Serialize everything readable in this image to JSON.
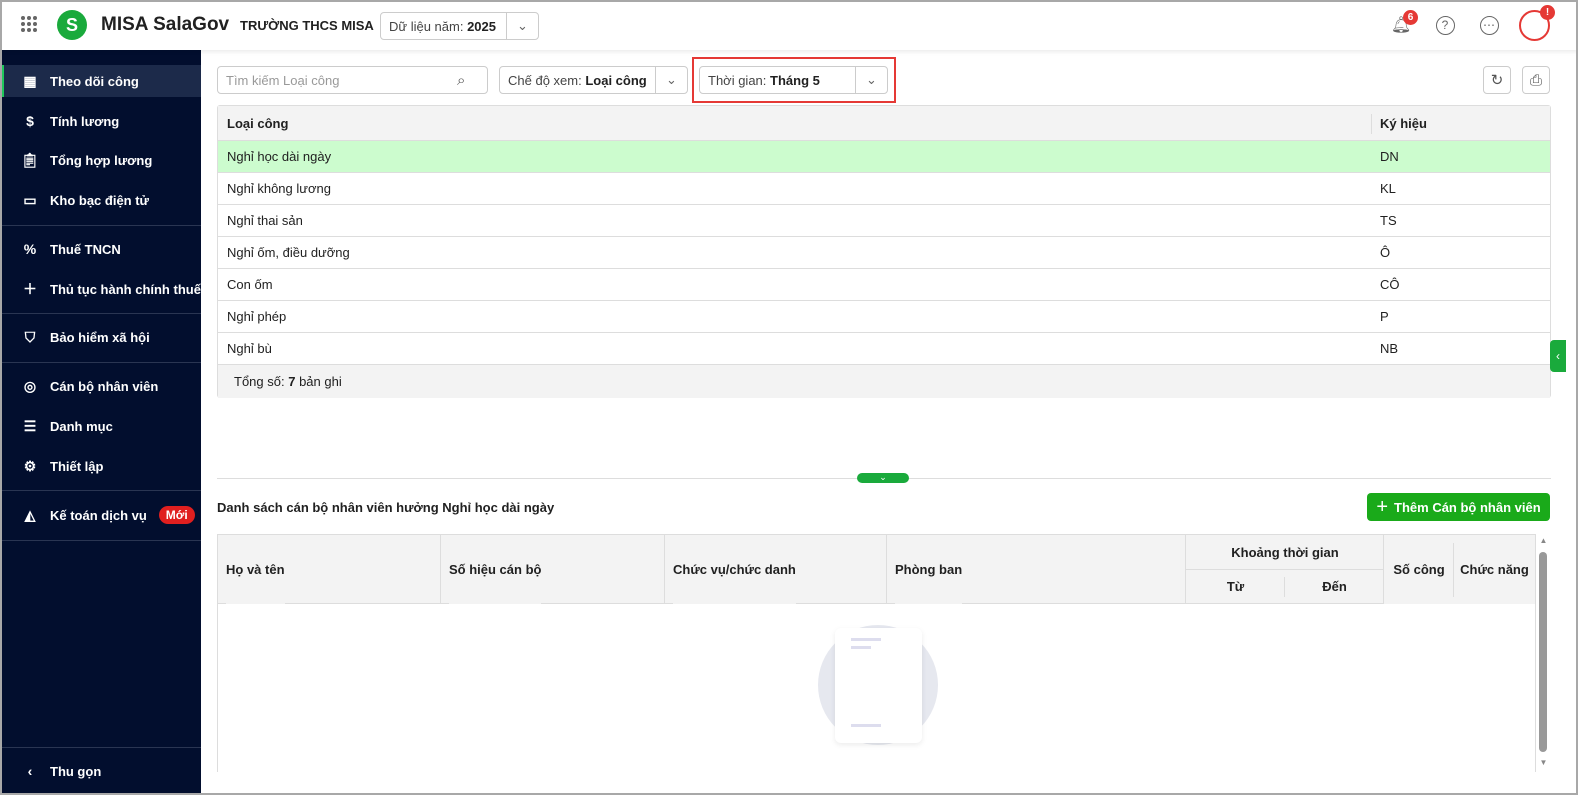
{
  "header": {
    "brand": "MISA SalaGov",
    "school": "TRƯỜNG THCS MISA",
    "year_label": "Dữ liệu năm:",
    "year_value": "2025",
    "notif_count": "6",
    "avatar_badge": "!"
  },
  "sidebar": {
    "items": [
      {
        "label": "Theo dõi công",
        "icon": "calendar-icon"
      },
      {
        "label": "Tính lương",
        "icon": "money-icon"
      },
      {
        "label": "Tổng hợp lương",
        "icon": "clipboard-icon"
      },
      {
        "label": "Kho bạc điện tử",
        "icon": "monitor-icon"
      },
      {
        "label": "Thuế TNCN",
        "icon": "tax-doc-icon"
      },
      {
        "label": "Thủ tục hành chính thuế",
        "icon": "doc-plus-icon"
      },
      {
        "label": "Bảo hiểm xã hội",
        "icon": "shield-icon"
      },
      {
        "label": "Cán bộ nhân viên",
        "icon": "people-icon"
      },
      {
        "label": "Danh mục",
        "icon": "list-icon"
      },
      {
        "label": "Thiết lập",
        "icon": "gear-icon"
      },
      {
        "label": "Kế toán dịch vụ",
        "icon": "accounting-icon",
        "badge": "Mới"
      }
    ],
    "collapse": "Thu gọn"
  },
  "toolbar": {
    "search_placeholder": "Tìm kiếm Loại công",
    "view_label": "Chế độ xem:",
    "view_value": "Loại công",
    "time_label": "Thời gian:",
    "time_value": "Tháng 5"
  },
  "table1": {
    "headers": [
      "Loại công",
      "Ký hiệu"
    ],
    "rows": [
      [
        "Nghỉ học dài ngày",
        "DN"
      ],
      [
        "Nghỉ không lương",
        "KL"
      ],
      [
        "Nghỉ thai sản",
        "TS"
      ],
      [
        "Nghỉ ốm, điều dưỡng",
        "Ô"
      ],
      [
        "Con ốm",
        "CÔ"
      ],
      [
        "Nghỉ phép",
        "P"
      ],
      [
        "Nghỉ bù",
        "NB"
      ]
    ],
    "footer_label": "Tổng số:",
    "footer_count": "7",
    "footer_suffix": "bản ghi"
  },
  "section": {
    "title": "Danh sách cán bộ nhân viên hưởng Nghỉ học dài ngày",
    "add_button": "Thêm Cán bộ nhân viên"
  },
  "table2": {
    "headers": {
      "name": "Họ và tên",
      "code": "Số hiệu cán bộ",
      "position": "Chức vụ/chức danh",
      "dept": "Phòng ban",
      "period": "Khoảng thời gian",
      "from": "Từ",
      "to": "Đến",
      "days": "Số công",
      "actions": "Chức năng"
    }
  },
  "colors": {
    "accent": "#1aaa3c",
    "sidebar": "#020e2e",
    "selected_row": "#ccfcce",
    "highlight": "#e53935"
  }
}
